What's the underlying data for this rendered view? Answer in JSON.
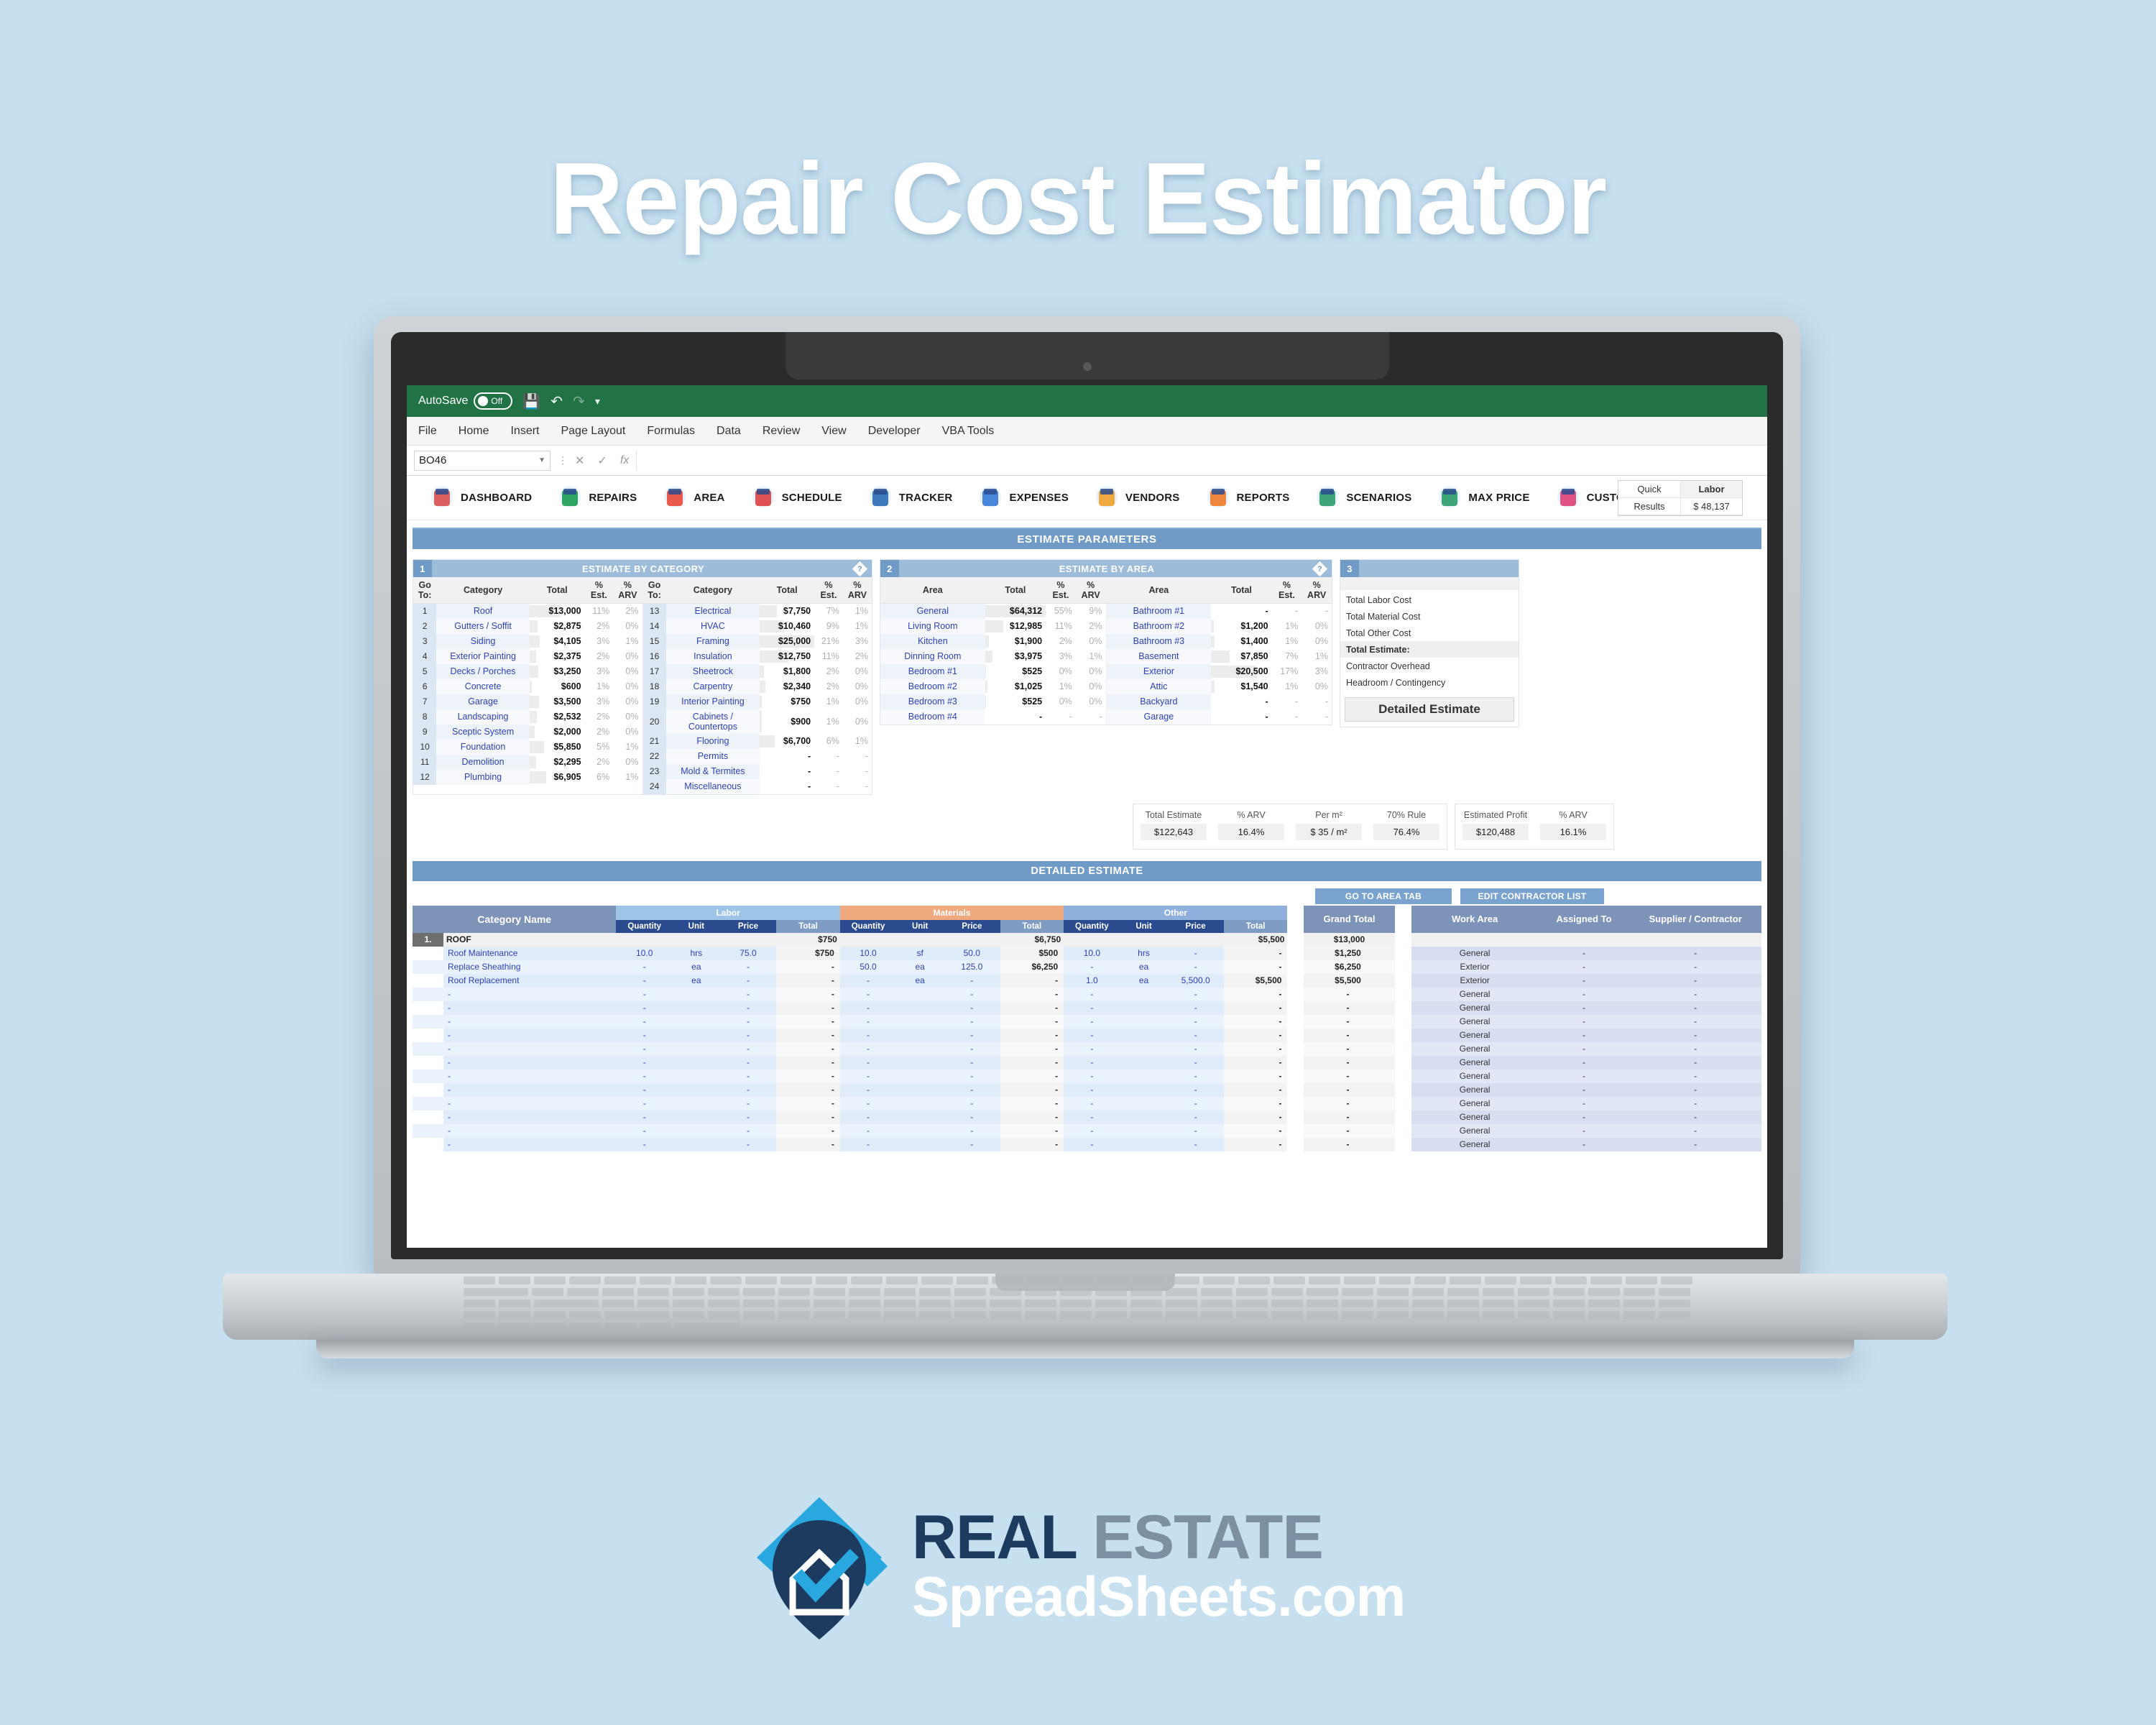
{
  "page": {
    "title": "Repair Cost Estimator",
    "background_color": "#c7e0f0"
  },
  "excel": {
    "autosave_label": "AutoSave",
    "autosave_state": "Off",
    "quick_access": [
      "save-icon",
      "undo-icon",
      "redo-icon",
      "customize-icon"
    ],
    "menus": [
      "File",
      "Home",
      "Insert",
      "Page Layout",
      "Formulas",
      "Data",
      "Review",
      "View",
      "Developer",
      "VBA Tools"
    ],
    "name_box": "BO46",
    "formula_bar": "",
    "formula_buttons": [
      "cancel-icon",
      "enter-icon",
      "insert-function-icon"
    ]
  },
  "nav": {
    "items": [
      {
        "label": "DASHBOARD",
        "icon": "house-dashboard-icon",
        "color": "#d9534f"
      },
      {
        "label": "REPAIRS",
        "icon": "tools-clipboard-icon",
        "color": "#1f9d55"
      },
      {
        "label": "AREA",
        "icon": "map-pin-icon",
        "color": "#e84c3d"
      },
      {
        "label": "SCHEDULE",
        "icon": "calendar-check-icon",
        "color": "#d44"
      },
      {
        "label": "TRACKER",
        "icon": "tracker-board-icon",
        "color": "#2f6fb5"
      },
      {
        "label": "EXPENSES",
        "icon": "monitor-phone-icon",
        "color": "#3b7dd8"
      },
      {
        "label": "VENDORS",
        "icon": "person-suit-icon",
        "color": "#f0a330"
      },
      {
        "label": "REPORTS",
        "icon": "report-chart-icon",
        "color": "#ef7d2e"
      },
      {
        "label": "SCENARIOS",
        "icon": "list-search-icon",
        "color": "#2f9e6e"
      },
      {
        "label": "MAX PRICE",
        "icon": "price-target-icon",
        "color": "#2f9e6e"
      },
      {
        "label": "CUSTOM",
        "icon": "custom-window-icon",
        "color": "#e0457b"
      }
    ],
    "quick_results": {
      "line1": "Quick",
      "line2": "Results",
      "metric_label": "Labor",
      "metric_value": "$ 48,137"
    }
  },
  "banner": {
    "estimate_parameters": "ESTIMATE PARAMETERS"
  },
  "panel1": {
    "number": "1",
    "title": "ESTIMATE BY CATEGORY",
    "help_icon": "help-diamond-icon",
    "headers": [
      "Go To:",
      "Category",
      "Total",
      "% Est.",
      "% ARV"
    ],
    "rows_left": [
      {
        "n": "1",
        "category": "Roof",
        "total": "$13,000",
        "est": "11%",
        "arv": "2%",
        "bar": 56
      },
      {
        "n": "2",
        "category": "Gutters / Soffit",
        "total": "$2,875",
        "est": "2%",
        "arv": "0%",
        "bar": 14
      },
      {
        "n": "3",
        "category": "Siding",
        "total": "$4,105",
        "est": "3%",
        "arv": "1%",
        "bar": 18
      },
      {
        "n": "4",
        "category": "Exterior Painting",
        "total": "$2,375",
        "est": "2%",
        "arv": "0%",
        "bar": 12
      },
      {
        "n": "5",
        "category": "Decks / Porches",
        "total": "$3,250",
        "est": "3%",
        "arv": "0%",
        "bar": 16
      },
      {
        "n": "6",
        "category": "Concrete",
        "total": "$600",
        "est": "1%",
        "arv": "0%",
        "bar": 4
      },
      {
        "n": "7",
        "category": "Garage",
        "total": "$3,500",
        "est": "3%",
        "arv": "0%",
        "bar": 17
      },
      {
        "n": "8",
        "category": "Landscaping",
        "total": "$2,532",
        "est": "2%",
        "arv": "0%",
        "bar": 13
      },
      {
        "n": "9",
        "category": "Sceptic System",
        "total": "$2,000",
        "est": "2%",
        "arv": "0%",
        "bar": 10
      },
      {
        "n": "10",
        "category": "Foundation",
        "total": "$5,850",
        "est": "5%",
        "arv": "1%",
        "bar": 26
      },
      {
        "n": "11",
        "category": "Demolition",
        "total": "$2,295",
        "est": "2%",
        "arv": "0%",
        "bar": 12
      },
      {
        "n": "12",
        "category": "Plumbing",
        "total": "$6,905",
        "est": "6%",
        "arv": "1%",
        "bar": 30
      }
    ],
    "rows_right": [
      {
        "n": "13",
        "category": "Electrical",
        "total": "$7,750",
        "est": "7%",
        "arv": "1%",
        "bar": 32
      },
      {
        "n": "14",
        "category": "HVAC",
        "total": "$10,460",
        "est": "9%",
        "arv": "1%",
        "bar": 44
      },
      {
        "n": "15",
        "category": "Framing",
        "total": "$25,000",
        "est": "21%",
        "arv": "3%",
        "bar": 100
      },
      {
        "n": "16",
        "category": "Insulation",
        "total": "$12,750",
        "est": "11%",
        "arv": "2%",
        "bar": 53
      },
      {
        "n": "17",
        "category": "Sheetrock",
        "total": "$1,800",
        "est": "2%",
        "arv": "0%",
        "bar": 8
      },
      {
        "n": "18",
        "category": "Carpentry",
        "total": "$2,340",
        "est": "2%",
        "arv": "0%",
        "bar": 10
      },
      {
        "n": "19",
        "category": "Interior Painting",
        "total": "$750",
        "est": "1%",
        "arv": "0%",
        "bar": 4
      },
      {
        "n": "20",
        "category": "Cabinets / Countertops",
        "total": "$900",
        "est": "1%",
        "arv": "0%",
        "bar": 4
      },
      {
        "n": "21",
        "category": "Flooring",
        "total": "$6,700",
        "est": "6%",
        "arv": "1%",
        "bar": 28
      },
      {
        "n": "22",
        "category": "Permits",
        "total": "-",
        "est": "-",
        "arv": "-",
        "bar": 0
      },
      {
        "n": "23",
        "category": "Mold & Termites",
        "total": "-",
        "est": "-",
        "arv": "-",
        "bar": 0
      },
      {
        "n": "24",
        "category": "Miscellaneous",
        "total": "-",
        "est": "-",
        "arv": "-",
        "bar": 0
      }
    ]
  },
  "panel2": {
    "number": "2",
    "title": "ESTIMATE BY AREA",
    "help_icon": "help-diamond-icon",
    "headers": [
      "Area",
      "Total",
      "% Est.",
      "% ARV"
    ],
    "rows_left": [
      {
        "area": "General",
        "total": "$64,312",
        "est": "55%",
        "arv": "9%",
        "bar": 100
      },
      {
        "area": "Living Room",
        "total": "$12,985",
        "est": "11%",
        "arv": "2%",
        "bar": 30
      },
      {
        "area": "Kitchen",
        "total": "$1,900",
        "est": "2%",
        "arv": "0%",
        "bar": 6
      },
      {
        "area": "Dinning Room",
        "total": "$3,975",
        "est": "3%",
        "arv": "1%",
        "bar": 12
      },
      {
        "area": "Bedroom #1",
        "total": "$525",
        "est": "0%",
        "arv": "0%",
        "bar": 2
      },
      {
        "area": "Bedroom #2",
        "total": "$1,025",
        "est": "1%",
        "arv": "0%",
        "bar": 4
      },
      {
        "area": "Bedroom #3",
        "total": "$525",
        "est": "0%",
        "arv": "0%",
        "bar": 2
      },
      {
        "area": "Bedroom #4",
        "total": "-",
        "est": "-",
        "arv": "-",
        "bar": 0
      }
    ],
    "rows_right": [
      {
        "area": "Bathroom #1",
        "total": "-",
        "est": "-",
        "arv": "-",
        "bar": 0
      },
      {
        "area": "Bathroom #2",
        "total": "$1,200",
        "est": "1%",
        "arv": "0%",
        "bar": 5
      },
      {
        "area": "Bathroom #3",
        "total": "$1,400",
        "est": "1%",
        "arv": "0%",
        "bar": 6
      },
      {
        "area": "Basement",
        "total": "$7,850",
        "est": "7%",
        "arv": "1%",
        "bar": 30
      },
      {
        "area": "Exterior",
        "total": "$20,500",
        "est": "17%",
        "arv": "3%",
        "bar": 75
      },
      {
        "area": "Attic",
        "total": "$1,540",
        "est": "1%",
        "arv": "0%",
        "bar": 6
      },
      {
        "area": "Backyard",
        "total": "-",
        "est": "-",
        "arv": "-",
        "bar": 0
      },
      {
        "area": "Garage",
        "total": "-",
        "est": "-",
        "arv": "-",
        "bar": 0
      }
    ]
  },
  "summary": {
    "left": [
      {
        "label": "Total Estimate",
        "value": "$122,643"
      },
      {
        "label": "% ARV",
        "value": "16.4%"
      },
      {
        "label": "Per m²",
        "value": "$ 35 / m²"
      },
      {
        "label": "70% Rule",
        "value": "76.4%"
      }
    ],
    "right": [
      {
        "label": "Estimated Profit",
        "value": "$120,488"
      },
      {
        "label": "% ARV",
        "value": "16.1%"
      }
    ]
  },
  "panel3": {
    "number": "3",
    "title": "",
    "rows": [
      "Total Labor Cost",
      "Total Material Cost",
      "Total Other Cost",
      "Total Estimate:",
      "Contractor Overhead",
      "Headroom / Contingency"
    ],
    "button_label": "Detailed Estimate"
  },
  "detailed": {
    "banner": "DETAILED ESTIMATE",
    "tag_area": "GO TO AREA TAB",
    "tag_contractor": "EDIT CONTRACTOR LIST",
    "group_headers": {
      "category": "Category Name",
      "labor": "Labor",
      "materials": "Materials",
      "other": "Other",
      "grand_total": "Grand Total",
      "work_area": "Work Area",
      "assigned_to": "Assigned To",
      "supplier": "Supplier / Contractor"
    },
    "sub_headers": [
      "Quantity",
      "Unit",
      "Price",
      "Total"
    ],
    "group_row": {
      "number": "1.",
      "name": "ROOF",
      "labor_total": "$750",
      "materials_total": "$6,750",
      "other_total": "$5,500",
      "grand_total": "$13,000"
    },
    "rows": [
      {
        "name": "Roof Maintenance",
        "lq": "10.0",
        "lu": "hrs",
        "lp": "75.0",
        "lt": "$750",
        "mq": "10.0",
        "mu": "sf",
        "mp": "50.0",
        "mt": "$500",
        "oq": "10.0",
        "ou": "hrs",
        "op": "-",
        "ot": "-",
        "gt": "$1,250",
        "wa": "General",
        "at": "-",
        "sc": "-"
      },
      {
        "name": "Replace Sheathing",
        "lq": "-",
        "lu": "ea",
        "lp": "-",
        "lt": "-",
        "mq": "50.0",
        "mu": "ea",
        "mp": "125.0",
        "mt": "$6,250",
        "oq": "-",
        "ou": "ea",
        "op": "-",
        "ot": "-",
        "gt": "$6,250",
        "wa": "Exterior",
        "at": "-",
        "sc": "-"
      },
      {
        "name": "Roof Replacement",
        "lq": "-",
        "lu": "ea",
        "lp": "-",
        "lt": "-",
        "mq": "-",
        "mu": "ea",
        "mp": "-",
        "mt": "-",
        "oq": "1.0",
        "ou": "ea",
        "op": "5,500.0",
        "ot": "$5,500",
        "gt": "$5,500",
        "wa": "Exterior",
        "at": "-",
        "sc": "-"
      },
      {
        "name": "-",
        "lq": "-",
        "lu": "",
        "lp": "-",
        "lt": "-",
        "mq": "-",
        "mu": "",
        "mp": "-",
        "mt": "-",
        "oq": "-",
        "ou": "",
        "op": "-",
        "ot": "-",
        "gt": "-",
        "wa": "General",
        "at": "-",
        "sc": "-"
      },
      {
        "name": "-",
        "lq": "-",
        "lu": "",
        "lp": "-",
        "lt": "-",
        "mq": "-",
        "mu": "",
        "mp": "-",
        "mt": "-",
        "oq": "-",
        "ou": "",
        "op": "-",
        "ot": "-",
        "gt": "-",
        "wa": "General",
        "at": "-",
        "sc": "-"
      },
      {
        "name": "-",
        "lq": "-",
        "lu": "",
        "lp": "-",
        "lt": "-",
        "mq": "-",
        "mu": "",
        "mp": "-",
        "mt": "-",
        "oq": "-",
        "ou": "",
        "op": "-",
        "ot": "-",
        "gt": "-",
        "wa": "General",
        "at": "-",
        "sc": "-"
      },
      {
        "name": "-",
        "lq": "-",
        "lu": "",
        "lp": "-",
        "lt": "-",
        "mq": "-",
        "mu": "",
        "mp": "-",
        "mt": "-",
        "oq": "-",
        "ou": "",
        "op": "-",
        "ot": "-",
        "gt": "-",
        "wa": "General",
        "at": "-",
        "sc": "-"
      },
      {
        "name": "-",
        "lq": "-",
        "lu": "",
        "lp": "-",
        "lt": "-",
        "mq": "-",
        "mu": "",
        "mp": "-",
        "mt": "-",
        "oq": "-",
        "ou": "",
        "op": "-",
        "ot": "-",
        "gt": "-",
        "wa": "General",
        "at": "-",
        "sc": "-"
      },
      {
        "name": "-",
        "lq": "-",
        "lu": "",
        "lp": "-",
        "lt": "-",
        "mq": "-",
        "mu": "",
        "mp": "-",
        "mt": "-",
        "oq": "-",
        "ou": "",
        "op": "-",
        "ot": "-",
        "gt": "-",
        "wa": "General",
        "at": "-",
        "sc": "-"
      },
      {
        "name": "-",
        "lq": "-",
        "lu": "",
        "lp": "-",
        "lt": "-",
        "mq": "-",
        "mu": "",
        "mp": "-",
        "mt": "-",
        "oq": "-",
        "ou": "",
        "op": "-",
        "ot": "-",
        "gt": "-",
        "wa": "General",
        "at": "-",
        "sc": "-"
      },
      {
        "name": "-",
        "lq": "-",
        "lu": "",
        "lp": "-",
        "lt": "-",
        "mq": "-",
        "mu": "",
        "mp": "-",
        "mt": "-",
        "oq": "-",
        "ou": "",
        "op": "-",
        "ot": "-",
        "gt": "-",
        "wa": "General",
        "at": "-",
        "sc": "-"
      },
      {
        "name": "-",
        "lq": "-",
        "lu": "",
        "lp": "-",
        "lt": "-",
        "mq": "-",
        "mu": "",
        "mp": "-",
        "mt": "-",
        "oq": "-",
        "ou": "",
        "op": "-",
        "ot": "-",
        "gt": "-",
        "wa": "General",
        "at": "-",
        "sc": "-"
      },
      {
        "name": "-",
        "lq": "-",
        "lu": "",
        "lp": "-",
        "lt": "-",
        "mq": "-",
        "mu": "",
        "mp": "-",
        "mt": "-",
        "oq": "-",
        "ou": "",
        "op": "-",
        "ot": "-",
        "gt": "-",
        "wa": "General",
        "at": "-",
        "sc": "-"
      },
      {
        "name": "-",
        "lq": "-",
        "lu": "",
        "lp": "-",
        "lt": "-",
        "mq": "-",
        "mu": "",
        "mp": "-",
        "mt": "-",
        "oq": "-",
        "ou": "",
        "op": "-",
        "ot": "-",
        "gt": "-",
        "wa": "General",
        "at": "-",
        "sc": "-"
      },
      {
        "name": "-",
        "lq": "-",
        "lu": "",
        "lp": "-",
        "lt": "-",
        "mq": "-",
        "mu": "",
        "mp": "-",
        "mt": "-",
        "oq": "-",
        "ou": "",
        "op": "-",
        "ot": "-",
        "gt": "-",
        "wa": "General",
        "at": "-",
        "sc": "-"
      }
    ]
  },
  "footer": {
    "brand_line1_a": "REAL",
    "brand_line1_b": "ESTATE",
    "brand_line2": "SpreadSheets.com",
    "logo_icon": "house-check-pin-logo"
  }
}
